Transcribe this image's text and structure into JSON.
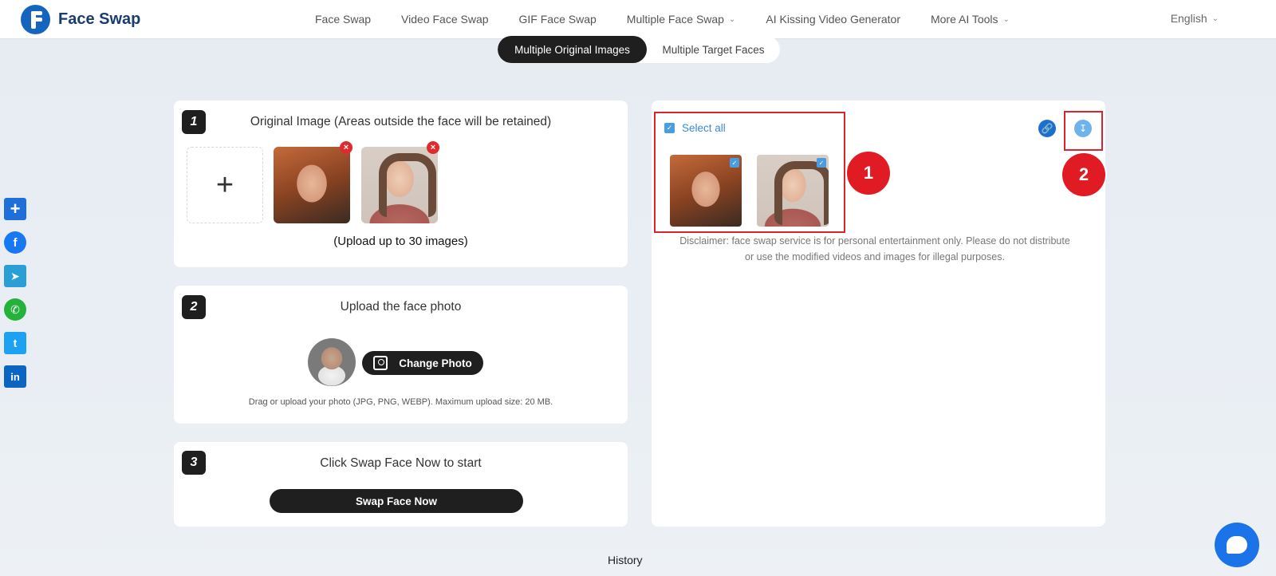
{
  "header": {
    "logo_text": "Face Swap",
    "nav": [
      {
        "label": "Face Swap",
        "dropdown": false
      },
      {
        "label": "Video Face Swap",
        "dropdown": false
      },
      {
        "label": "GIF Face Swap",
        "dropdown": false
      },
      {
        "label": "Multiple Face Swap",
        "dropdown": true
      },
      {
        "label": "AI Kissing Video Generator",
        "dropdown": false
      },
      {
        "label": "More AI Tools",
        "dropdown": true
      }
    ],
    "language": "English"
  },
  "mode_switch": {
    "active": "Multiple Original Images",
    "inactive": "Multiple Target Faces"
  },
  "social": [
    "share-plus",
    "facebook",
    "telegram",
    "whatsapp",
    "twitter",
    "linkedin"
  ],
  "step1": {
    "number": "1",
    "title": "Original Image (Areas outside the face will be retained)",
    "add_symbol": "+",
    "hint": "(Upload up to 30 images)"
  },
  "step2": {
    "number": "2",
    "title": "Upload the face photo",
    "change_button": "Change Photo",
    "hint": "Drag or upload your photo (JPG, PNG, WEBP). Maximum upload size: 20 MB."
  },
  "step3": {
    "number": "3",
    "title": "Click Swap Face Now to start",
    "button": "Swap Face Now"
  },
  "result": {
    "select_all": "Select all",
    "marker1": "1",
    "marker2": "2",
    "disclaimer": "Disclaimer: face swap service is for personal entertainment only. Please do not distribute or use the modified videos and images for illegal purposes."
  },
  "history_label": "History",
  "colors": {
    "accent": "#1f1f1f",
    "brand": "#1565c0",
    "marker": "#e01b24",
    "link": "#3a8ad6"
  }
}
